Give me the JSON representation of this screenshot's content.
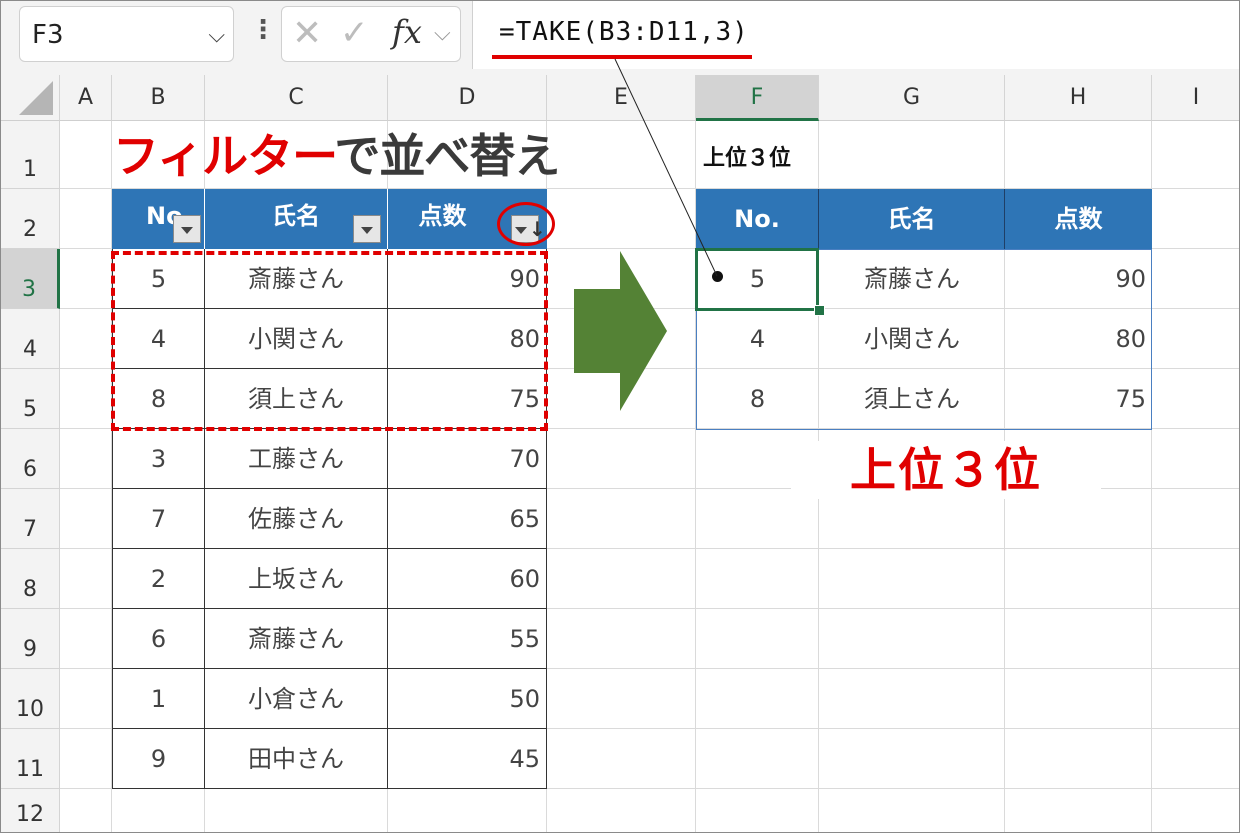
{
  "name_box": {
    "value": "F3"
  },
  "formula_bar": {
    "fx_label": "fx",
    "formula": "=TAKE(B3:D11,3)"
  },
  "columns": [
    "A",
    "B",
    "C",
    "D",
    "E",
    "F",
    "G",
    "H",
    "I"
  ],
  "selected_column": "F",
  "rows": [
    "1",
    "2",
    "3",
    "4",
    "5",
    "6",
    "7",
    "8",
    "9",
    "10",
    "11",
    "12"
  ],
  "selected_row": "3",
  "title": {
    "red_part": "フィルター",
    "dark_part": "で並べ替え"
  },
  "left_table": {
    "headers": [
      "No",
      "氏名",
      "点数"
    ],
    "rows": [
      [
        "5",
        "斎藤さん",
        "90"
      ],
      [
        "4",
        "小関さん",
        "80"
      ],
      [
        "8",
        "須上さん",
        "75"
      ],
      [
        "3",
        "工藤さん",
        "70"
      ],
      [
        "7",
        "佐藤さん",
        "65"
      ],
      [
        "2",
        "上坂さん",
        "60"
      ],
      [
        "6",
        "斎藤さん",
        "55"
      ],
      [
        "1",
        "小倉さん",
        "50"
      ],
      [
        "9",
        "田中さん",
        "45"
      ]
    ]
  },
  "right_table": {
    "caption": "上位３位",
    "headers": [
      "No.",
      "氏名",
      "点数"
    ],
    "rows": [
      [
        "5",
        "斎藤さん",
        "90"
      ],
      [
        "4",
        "小関さん",
        "80"
      ],
      [
        "8",
        "須上さん",
        "75"
      ]
    ]
  },
  "big_label": "上位３位",
  "colors": {
    "accent_red": "#e00000",
    "header_blue": "#2e75b6",
    "arrow_green": "#548235",
    "excel_green": "#217346"
  }
}
